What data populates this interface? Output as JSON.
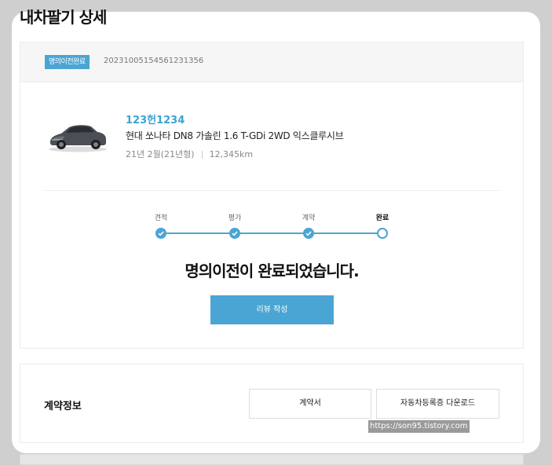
{
  "page": {
    "title": "내차팔기 상세"
  },
  "order": {
    "status_badge": "명의이전완료",
    "number": "20231005154561231356"
  },
  "car": {
    "image_icon": "car-image",
    "plate": "123헌1234",
    "model": "현대 쏘나타 DN8 가솔린 1.6 T-GDi 2WD 익스클루시브",
    "registration": "21년 2월(21년형)",
    "mileage": "12,345km"
  },
  "progress": {
    "steps": [
      {
        "label": "견적",
        "state": "done"
      },
      {
        "label": "평가",
        "state": "done"
      },
      {
        "label": "계약",
        "state": "done"
      },
      {
        "label": "완료",
        "state": "current"
      }
    ],
    "message": "명의이전이 완료되었습니다.",
    "accent_color": "#4aa5d4"
  },
  "actions": {
    "review_label": "리뷰 작성"
  },
  "contract": {
    "title": "계약정보",
    "contract_button": "계약서",
    "registration_download_button": "자동차등록증 다운로드"
  },
  "overlay": {
    "watermark": "https://son95.tistory.com"
  }
}
